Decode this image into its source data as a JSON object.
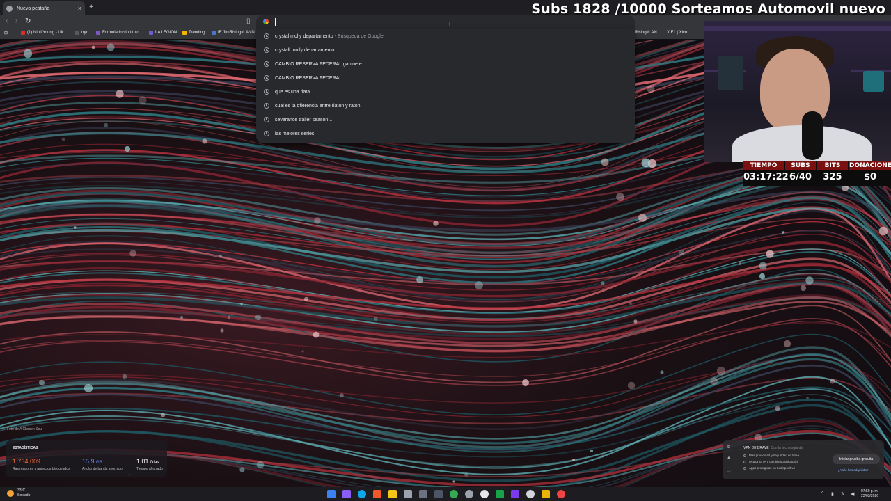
{
  "browser": {
    "tab_title": "Nueva pestaña",
    "tab_close": "×",
    "new_tab": "+"
  },
  "stream": {
    "title": "Subs 1828 /10000 Sorteamos Automovil nuevo"
  },
  "bookmarks": [
    {
      "label": "(1) Nihil Young - Ult...",
      "color": "#d32f2f"
    },
    {
      "label": "tryn",
      "color": "#5a5a5a"
    },
    {
      "label": "Formulario sin título...",
      "color": "#7e57c2"
    },
    {
      "label": "LA LEGION",
      "color": "#6d5dd3"
    },
    {
      "label": "Trending",
      "color": "#f4b400"
    },
    {
      "label": "IE JimRising#LANN...",
      "color": "#4a78c9"
    },
    {
      "label": "Rising#LAN...",
      "color": "#4a78c9"
    },
    {
      "label": "X F1 | Xico",
      "color": "#888888"
    }
  ],
  "omnibox": {
    "suggestions": [
      {
        "text": "crystal molly departamento",
        "sub": "- Búsqueda de Google"
      },
      {
        "text": "crystall molly departamento",
        "sub": ""
      },
      {
        "text": "CAMBIO RESERVA FEDERAL gabinete",
        "sub": ""
      },
      {
        "text": "CAMBIO RESERVA FEDERAL",
        "sub": ""
      },
      {
        "text": "que es una riata",
        "sub": ""
      },
      {
        "text": "cual es la dfierencia entre riaton y raton",
        "sub": ""
      },
      {
        "text": "severance trailer season 1",
        "sub": ""
      },
      {
        "text": "las mejores series",
        "sub": ""
      }
    ]
  },
  "stream_stats": {
    "tiempo_label": "TIEMPO",
    "tiempo": "03:17:22",
    "subs_label": "SUBS",
    "subs": "6/40",
    "bits_label": "BITS",
    "bits": "325",
    "donaciones_label": "DONACIONES",
    "donaciones": "$0"
  },
  "photo_credit": "Foto de A Chosen Soul",
  "estadisticas": {
    "title": "ESTADÍSTICAS",
    "items": [
      {
        "value": "1,734,009",
        "unit": "",
        "caption": "Rastreadores y anuncios bloqueados",
        "color": "#ff6b3d"
      },
      {
        "value": "15.9",
        "unit": "GB",
        "caption": "Ancho de banda ahorrado",
        "color": "#6a8cff"
      },
      {
        "value": "1.01",
        "unit": "Días",
        "caption": "Tiempo ahorrado",
        "color": "#ffffff"
      }
    ]
  },
  "vpn": {
    "title": "VPN DE BRAVE",
    "title_sub": "Con la tecnología de",
    "lines": [
      "Más privacidad y seguridad en línea",
      "Oculta su IP y cambia su ubicación",
      "Apps protegidas en tu dispositivo"
    ],
    "button": "Iniciar prueba gratuita",
    "link": "¿Ya lo has adquirido?"
  },
  "taskbar": {
    "temp": "33°C",
    "weather": "Soleado",
    "time": "07:59 p. m.",
    "date": "23/03/2026"
  }
}
